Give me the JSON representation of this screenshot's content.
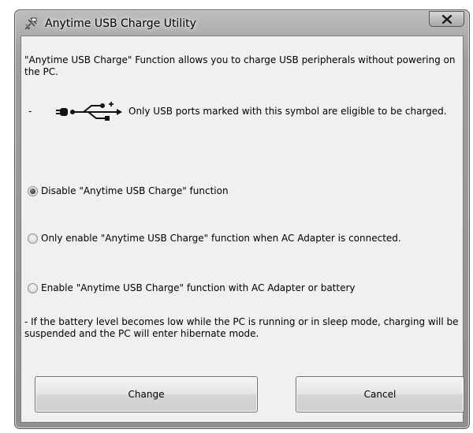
{
  "window": {
    "title": "Anytime USB Charge Utility",
    "close_label": "x"
  },
  "intro": "\"Anytime USB Charge\" Function allows you to charge USB peripherals without powering on the PC.",
  "usb_note": {
    "bullet": "-",
    "text": "Only USB ports marked with this symbol are eligible to be charged."
  },
  "options": [
    {
      "label": "Disable \"Anytime USB Charge\" function",
      "selected": true
    },
    {
      "label": "Only enable \"Anytime USB Charge\" function when AC Adapter is connected.",
      "selected": false
    },
    {
      "label": "Enable \"Anytime USB Charge\" function with AC Adapter or battery",
      "selected": false
    }
  ],
  "footer_note": "- If the battery level becomes low while the PC is running or in sleep mode, charging will be suspended and the PC will enter hibernate mode.",
  "buttons": {
    "change": "Change",
    "cancel": "Cancel"
  },
  "icons": {
    "title": "usb-charge-icon",
    "close": "close-icon",
    "usb": "usb-charge-symbol-icon"
  }
}
